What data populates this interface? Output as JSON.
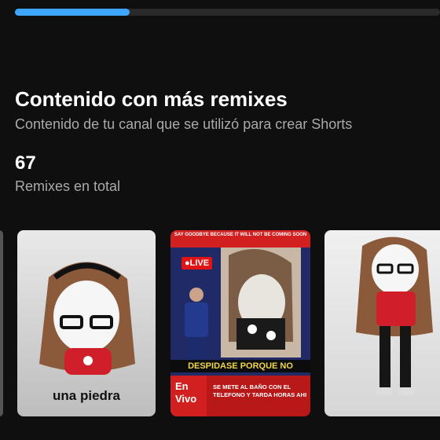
{
  "progress": {
    "fraction": 0.27,
    "color": "#3ea6ff"
  },
  "section": {
    "title": "Contenido con más remixes",
    "subtitle": "Contenido de tu canal que se utilizó para crear Shorts"
  },
  "total": {
    "value": "67",
    "label": "Remixes en total"
  },
  "cards": [
    {
      "caption": "una piedra"
    },
    {
      "top_banner": "SAY GOODBYE BECAUSE IT WILL NOT BE COMING SOON",
      "live_badge": "●LIVE",
      "ticker": "DESPIDASE PORQUE NO",
      "envivo_line1": "En",
      "envivo_line2": "Vivo",
      "bottom_text": "SE METE AL BAÑO CON EL TELEFONO Y TARDA HORAS AHI"
    },
    {
      "caption": ""
    }
  ]
}
